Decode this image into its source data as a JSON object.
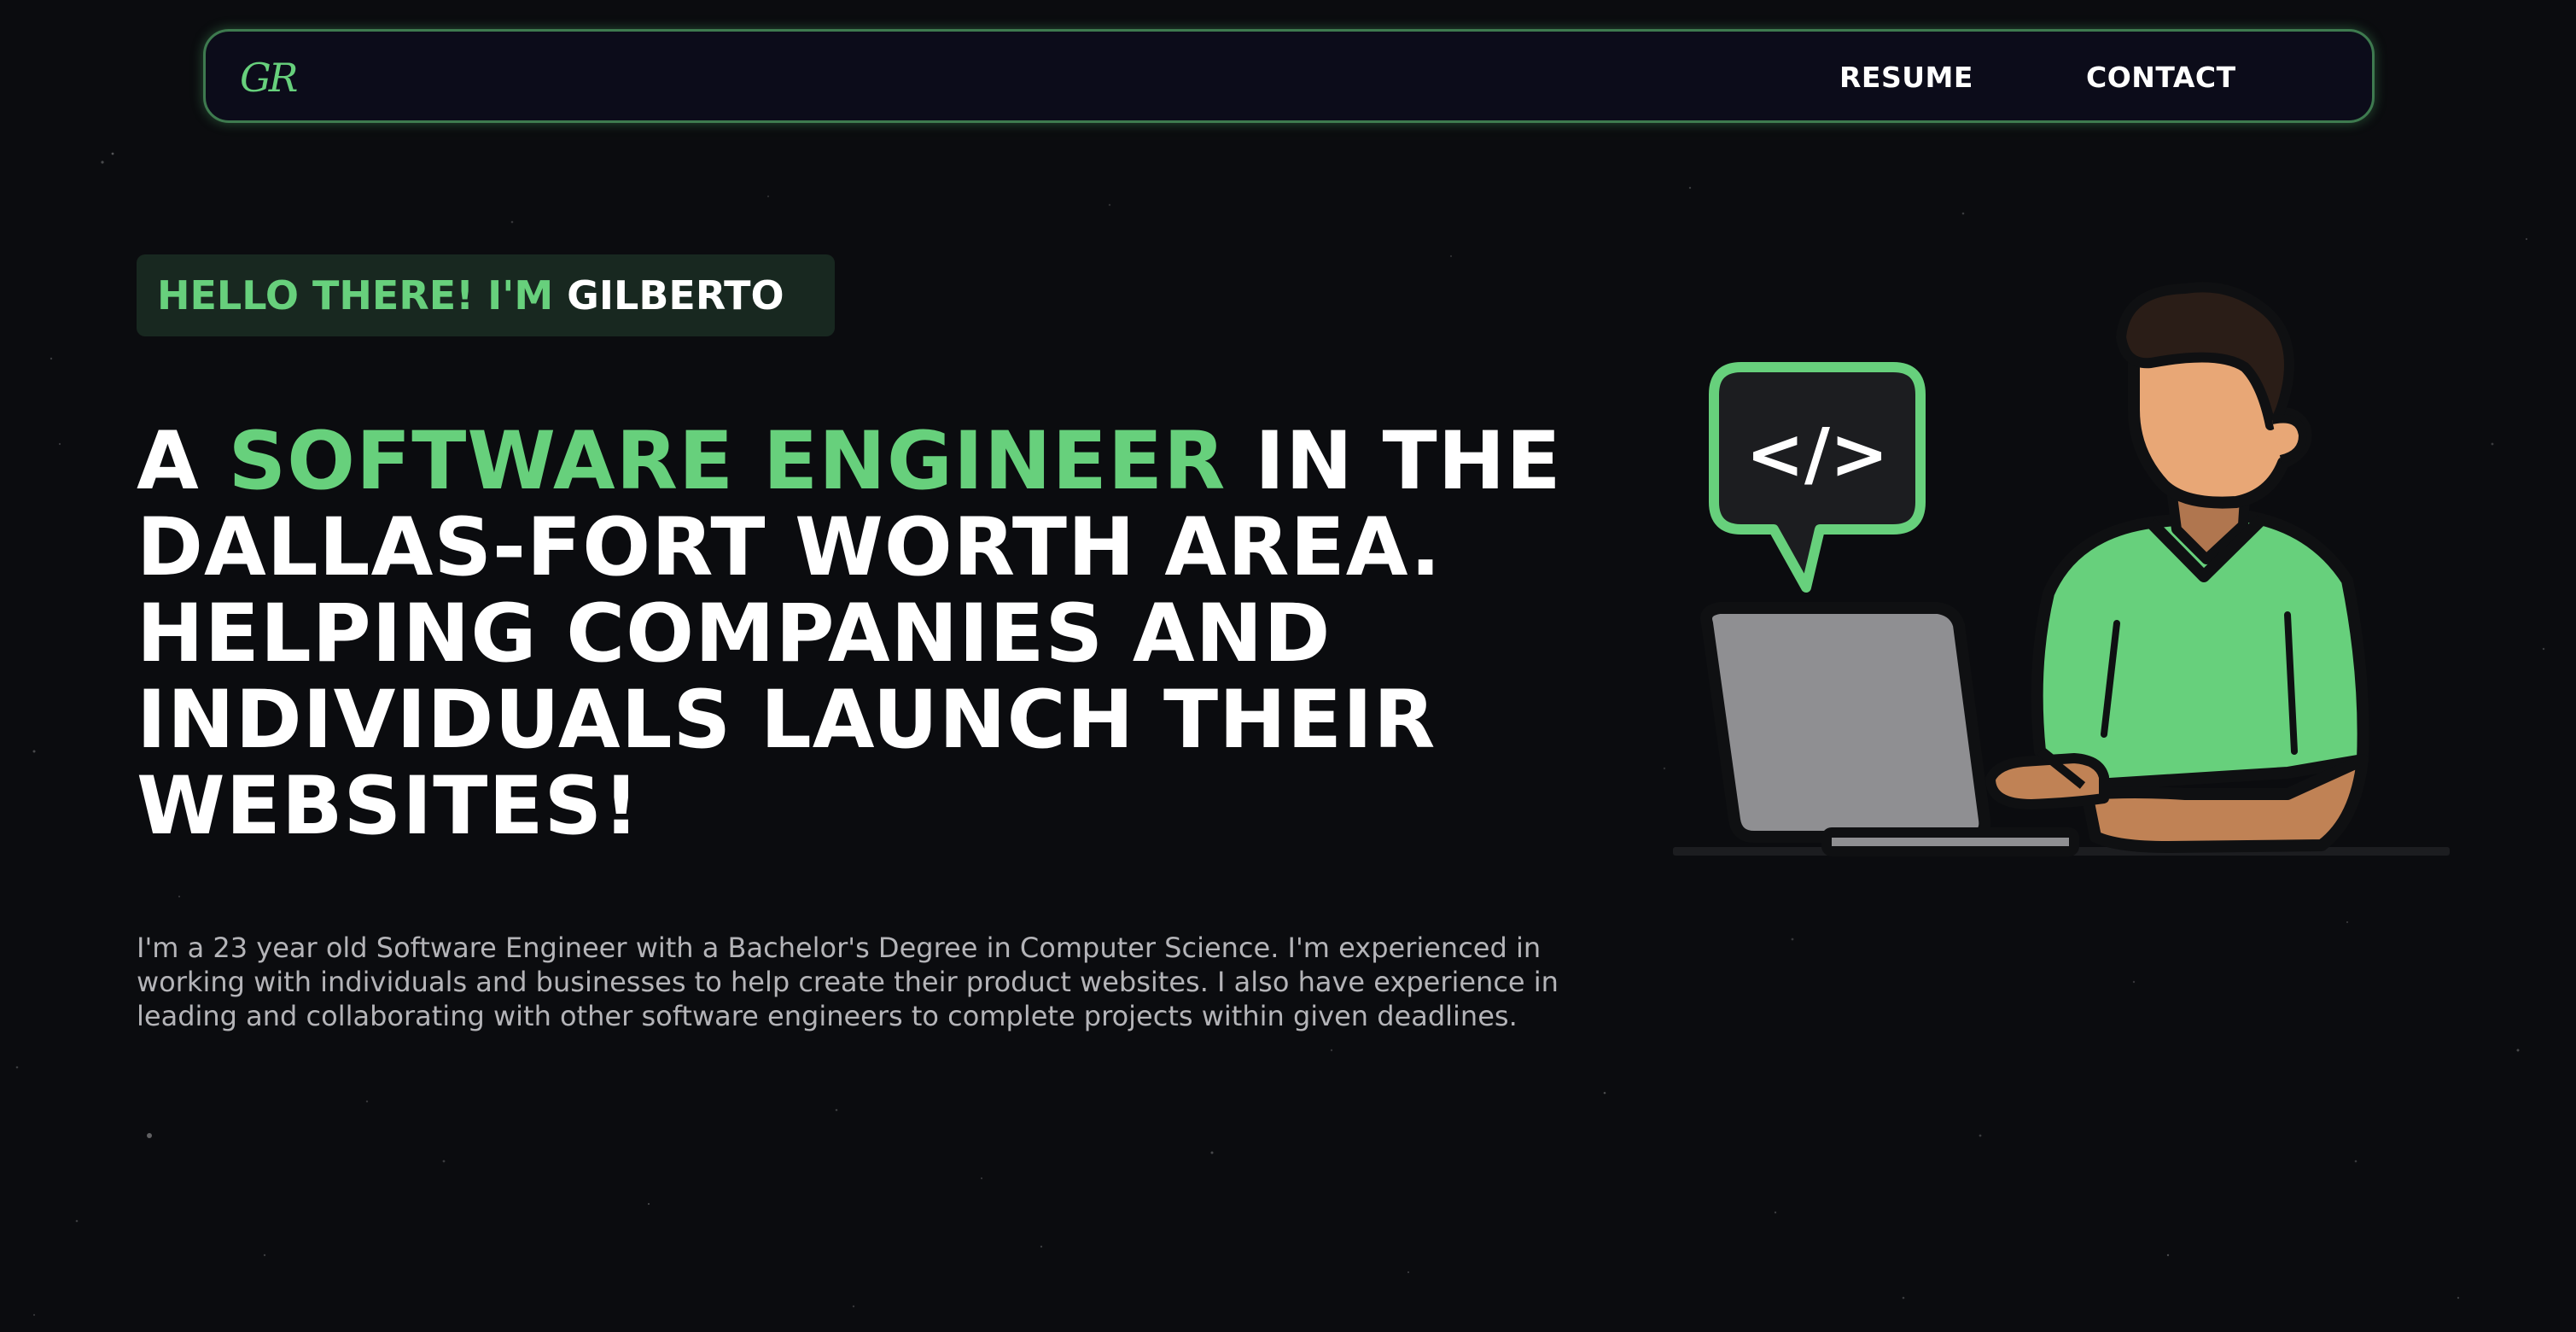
{
  "nav": {
    "logo": "GR",
    "links": [
      {
        "label": "RESUME"
      },
      {
        "label": "CONTACT"
      }
    ]
  },
  "hero": {
    "greeting_prefix": "HELLO THERE! I'M ",
    "greeting_name": "GILBERTO",
    "headline_lead": "A ",
    "headline_accent": "SOFTWARE ENGINEER",
    "headline_rest": " IN THE DALLAS-FORT WORTH AREA. HELPING COMPANIES AND INDIVIDUALS LAUNCH THEIR WEBSITES!",
    "bio": "I'm a 23 year old Software Engineer with a Bachelor's Degree in Computer Science. I'm experienced in working with individuals and businesses to help create their product websites. I also have experience in leading and collaborating with other software engineers to complete projects within given deadlines.",
    "illustration": {
      "icon": "developer-at-laptop-illustration",
      "code_bubble_text": "</>"
    }
  },
  "colors": {
    "accent": "#67d07c",
    "background": "#0b0c0f",
    "nav_background": "#0c0c1a",
    "badge_background": "#182820",
    "body_text": "#b4b4b8"
  }
}
